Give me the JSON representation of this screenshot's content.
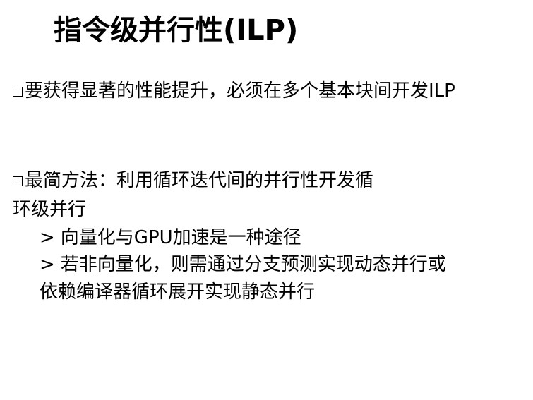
{
  "slide": {
    "title": "指令级并行性(ILP)",
    "bullet1": "要获得显著的性能提升，必须在多个基本块间开发ILP",
    "bullet2_line1": "最简方法：利用循环迭代间的并行性开发循",
    "bullet2_line2": "环级并行",
    "sub1_marker": ">",
    "sub1": "向量化与GPU加速是一种途径",
    "sub2_marker": ">",
    "sub2_line1": "若非向量化，则需通过分支预测实现动态并行或",
    "sub2_line2": "依赖编译器循环展开实现静态并行"
  }
}
